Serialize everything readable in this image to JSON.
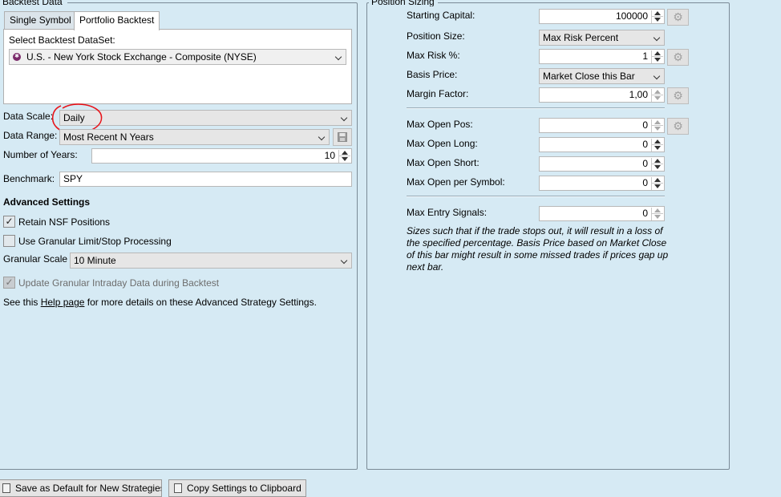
{
  "backtest_data": {
    "title": "Backtest Data",
    "tabs": [
      {
        "label": "Single Symbol"
      },
      {
        "label": "Portfolio Backtest"
      }
    ],
    "dataset_label": "Select Backtest DataSet:",
    "dataset_value": "U.S. - New York Stock Exchange - Composite (NYSE)",
    "data_scale_label": "Data Scale:",
    "data_scale_value": "Daily",
    "data_range_label": "Data Range:",
    "data_range_value": "Most Recent N Years",
    "years_label": "Number of Years:",
    "years_value": "10",
    "benchmark_label": "Benchmark:",
    "benchmark_value": "SPY",
    "advanced_title": "Advanced Settings",
    "retain_nsf_label": "Retain NSF Positions",
    "retain_nsf_checked": true,
    "granular_processing_label": "Use Granular Limit/Stop Processing",
    "granular_processing_checked": false,
    "granular_scale_label": "Granular Scale",
    "granular_scale_value": "10 Minute",
    "update_granular_label": "Update Granular Intraday Data during Backtest",
    "update_granular_checked": true,
    "help_prefix": "See this",
    "help_link": "Help page",
    "help_suffix": "for more details on these Advanced Strategy Settings."
  },
  "position_sizing": {
    "title": "Position Sizing",
    "starting_capital_label": "Starting Capital:",
    "starting_capital_value": "100000",
    "position_size_label": "Position Size:",
    "position_size_value": "Max Risk Percent",
    "max_risk_label": "Max Risk %:",
    "max_risk_value": "1",
    "basis_price_label": "Basis Price:",
    "basis_price_value": "Market Close this Bar",
    "margin_factor_label": "Margin Factor:",
    "margin_factor_value": "1,00",
    "max_open_pos_label": "Max Open Pos:",
    "max_open_pos_value": "0",
    "max_open_long_label": "Max Open Long:",
    "max_open_long_value": "0",
    "max_open_short_label": "Max Open Short:",
    "max_open_short_value": "0",
    "max_open_per_symbol_label": "Max Open per Symbol:",
    "max_open_per_symbol_value": "0",
    "max_entry_signals_label": "Max Entry Signals:",
    "max_entry_signals_value": "0",
    "description": "Sizes such that if the trade stops out, it will result in a loss of the specified percentage. Basis Price based on Market Close of this bar might result in some missed trades if prices gap up next bar."
  },
  "bottom_buttons": {
    "save_default_label": "Save as Default for New Strategies",
    "copy_settings_label": "Copy Settings to Clipboard"
  },
  "icons": {
    "gear": "gear-icon",
    "save": "floppy-disk-icon",
    "dataset": "dataset-icon",
    "annotation": "red-circle-annotation"
  },
  "colors": {
    "panel_bg": "#d6eaf4",
    "annotation": "#e8141a",
    "dataset_icon": "#7a2a6a"
  }
}
